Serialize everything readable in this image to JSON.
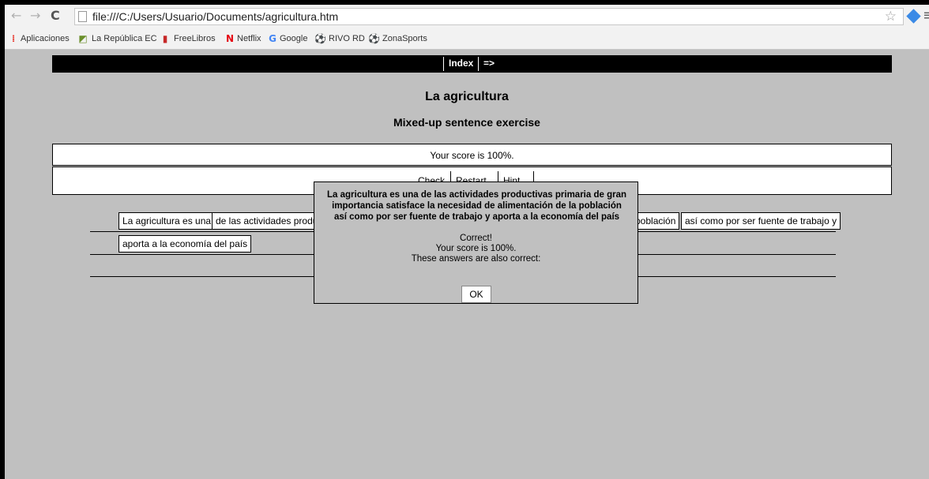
{
  "browser": {
    "url": "file:///C:/Users/Usuario/Documents/agricultura.htm",
    "back_icon": "←",
    "forward_icon": "→",
    "reload_icon": "C",
    "star_icon": "☆",
    "menu_icon": "≡",
    "bookmarks": [
      {
        "label": "Aplicaciones",
        "icon": "apps-grid-icon",
        "glyph": "⁞",
        "color": "#e8453c"
      },
      {
        "label": "La República EC",
        "icon": "larepublica-icon",
        "glyph": "◩",
        "color": "#6a8f2a"
      },
      {
        "label": "FreeLibros",
        "icon": "freelibros-icon",
        "glyph": "▮",
        "color": "#c62828"
      },
      {
        "label": "Netflix",
        "icon": "netflix-icon",
        "glyph": "N",
        "color": "#e50914"
      },
      {
        "label": "Google",
        "icon": "google-icon",
        "glyph": "G",
        "color": "#4285f4"
      },
      {
        "label": "RIVO RD",
        "icon": "soccer-ball-icon",
        "glyph": "⚽",
        "color": "#333333"
      },
      {
        "label": "ZonaSports",
        "icon": "zonasports-icon",
        "glyph": "⚽",
        "color": "#555555"
      }
    ]
  },
  "nav": {
    "index_label": "Index",
    "next_label": "=>"
  },
  "page": {
    "title": "La agricultura",
    "subtitle": "Mixed-up sentence exercise",
    "score": "Your score is 100%.",
    "buttons": {
      "check": "Check",
      "restart": "Restart",
      "hint": "Hint"
    }
  },
  "chunks": [
    "La agricultura es una",
    "de las actividades produ",
    "población",
    "así como por ser fuente de trabajo y",
    "aporta a la economía del país"
  ],
  "dialog": {
    "sentence": "La agricultura es una de las actividades productivas primaria de gran importancia satisface la necesidad de alimentación de la población así como por ser fuente de trabajo y aporta a la economía del país",
    "correct": "Correct!",
    "score": "Your score is 100%.",
    "also_correct": "These answers are also correct:",
    "ok_label": "OK"
  },
  "colors": {
    "page_bg": "#c0c0c0",
    "navbar_bg": "#000000"
  }
}
